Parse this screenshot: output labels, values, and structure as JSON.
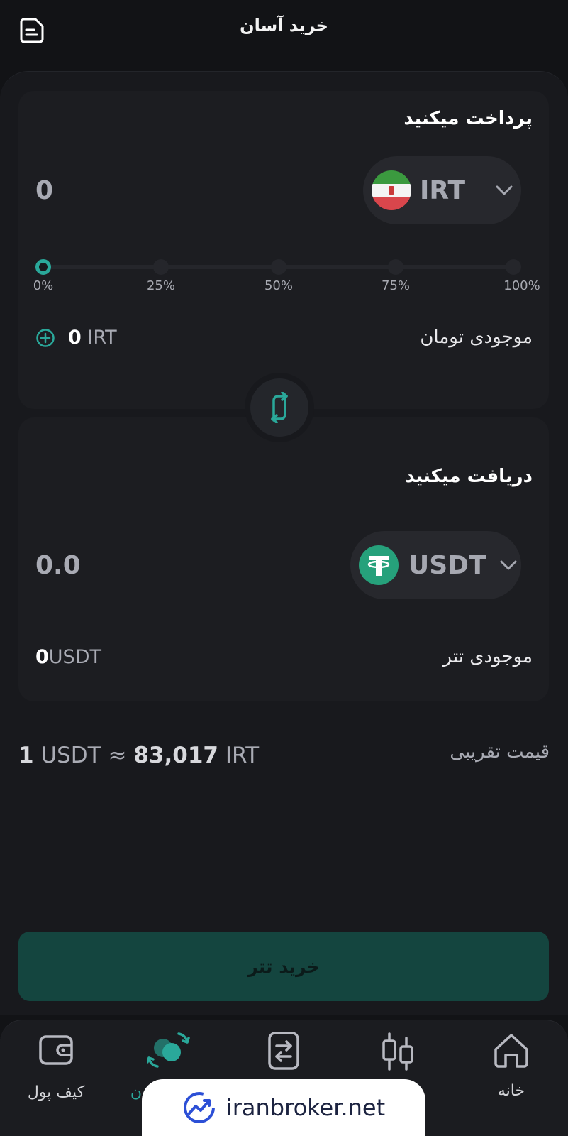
{
  "header": {
    "title": "خرید آسان",
    "doc_icon": "document-icon"
  },
  "pay": {
    "title": "پرداخت میکنید",
    "amount": "0",
    "currency": "IRT",
    "slider": {
      "value_percent": 0,
      "labels": [
        "0%",
        "25%",
        "50%",
        "75%",
        "100%"
      ]
    },
    "balance_label": "موجودی تومان",
    "balance_amount": "0",
    "balance_unit": "IRT"
  },
  "receive": {
    "title": "دریافت میکنید",
    "amount": "0.0",
    "currency": "USDT",
    "balance_label": "موجودی تتر",
    "balance_amount": "0",
    "balance_unit": "USDT"
  },
  "price": {
    "label": "قیمت تقریبی",
    "from_amount": "1",
    "from_unit": "USDT",
    "approx": "≈",
    "to_amount": "83,017",
    "to_unit": "IRT"
  },
  "buy_button": "خرید تتر",
  "nav": {
    "items": [
      {
        "label": "کیف پول",
        "icon": "wallet-icon"
      },
      {
        "label": "ن",
        "icon": "easy-buy-icon"
      },
      {
        "label": "",
        "icon": "exchange-icon"
      },
      {
        "label": "",
        "icon": "candlestick-icon"
      },
      {
        "label": "خانه",
        "icon": "home-icon"
      }
    ]
  },
  "watermark": "iranbroker.net",
  "colors": {
    "accent": "#2aa89a",
    "background": "#121316",
    "card": "#1c1d21",
    "buy_button": "#14453f",
    "usdt": "#26a17b"
  }
}
